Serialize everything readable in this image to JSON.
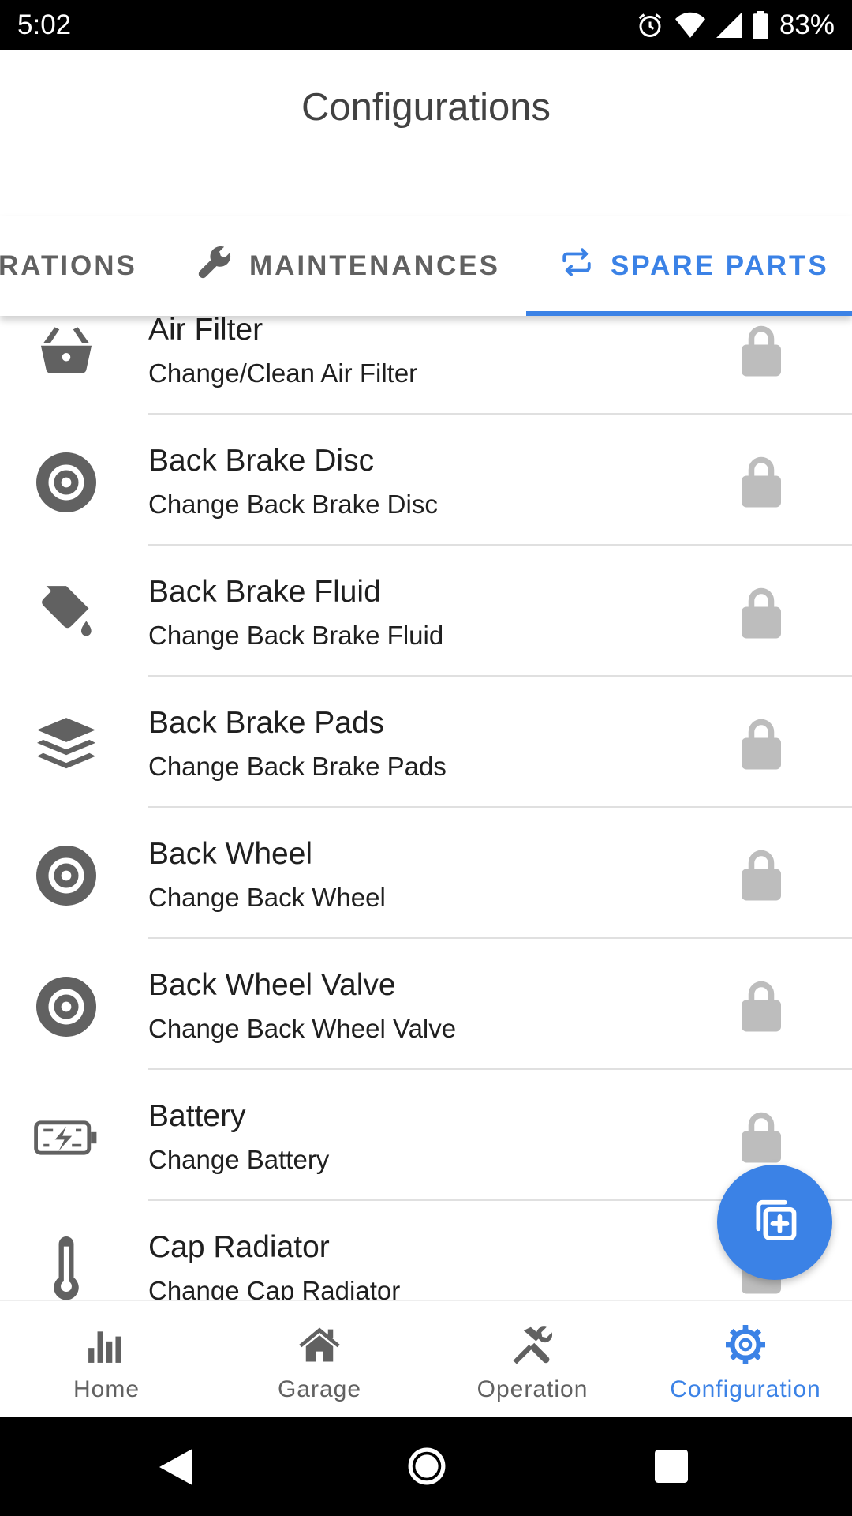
{
  "status_bar": {
    "time": "5:02",
    "battery": "83%"
  },
  "header": {
    "title": "Configurations"
  },
  "tabs": [
    {
      "label": "RATIONS",
      "icon": "partial-tab",
      "active": false
    },
    {
      "label": "MAINTENANCES",
      "icon": "wrench-icon",
      "active": false
    },
    {
      "label": "SPARE PARTS",
      "icon": "swap-icon",
      "active": true
    }
  ],
  "items": [
    {
      "title": "Air Filter",
      "subtitle": "Change/Clean Air Filter",
      "icon": "basket-icon"
    },
    {
      "title": "Back Brake Disc",
      "subtitle": "Change Back Brake Disc",
      "icon": "disc-icon"
    },
    {
      "title": "Back Brake Fluid",
      "subtitle": "Change Back Brake Fluid",
      "icon": "paint-bucket-icon"
    },
    {
      "title": "Back Brake Pads",
      "subtitle": "Change Back Brake Pads",
      "icon": "layers-icon"
    },
    {
      "title": "Back Wheel",
      "subtitle": "Change Back Wheel",
      "icon": "disc-icon"
    },
    {
      "title": "Back Wheel Valve",
      "subtitle": "Change Back Wheel Valve",
      "icon": "disc-icon"
    },
    {
      "title": "Battery",
      "subtitle": "Change Battery",
      "icon": "battery-charging-icon"
    },
    {
      "title": "Cap Radiator",
      "subtitle": "Change Cap Radiator",
      "icon": "thermometer-icon"
    }
  ],
  "bottom_nav": [
    {
      "label": "Home",
      "icon": "bar-chart-icon",
      "active": false
    },
    {
      "label": "Garage",
      "icon": "house-icon",
      "active": false
    },
    {
      "label": "Operation",
      "icon": "tools-icon",
      "active": false
    },
    {
      "label": "Configuration",
      "icon": "cog-icon",
      "active": true
    }
  ],
  "colors": {
    "accent": "#3b82e6",
    "icon_gray": "#616161",
    "lock_gray": "#bdbdbd"
  }
}
